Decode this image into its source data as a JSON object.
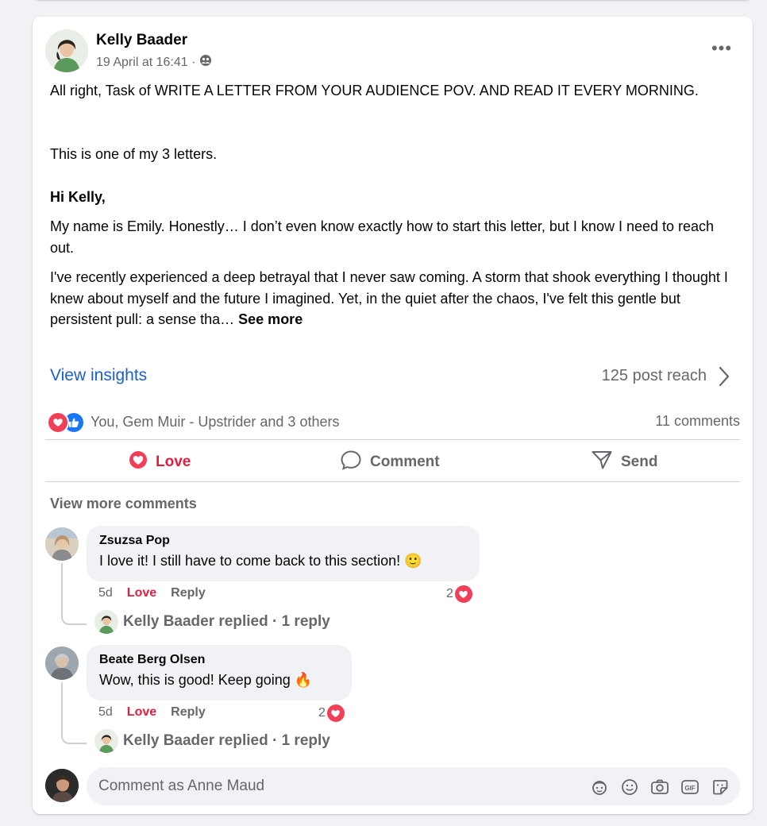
{
  "post": {
    "author": "Kelly Baader",
    "timestamp": "19 April at 16:41 ·",
    "privacy_icon": "group-icon",
    "body": {
      "p1": "All right, Task of WRITE A LETTER FROM YOUR AUDIENCE POV. AND READ IT EVERY MORNING.",
      "p2": "This is one of my 3 letters.",
      "p3": "Hi Kelly,",
      "p4": "My name is Emily. Honestly… I don’t even know exactly how to start this letter, but I know I need to reach out.",
      "p5": "I've recently experienced a deep betrayal that I never saw coming. A storm that shook everything I thought I knew about myself and the future I imagined. Yet, in the quiet after the chaos, I've felt this gentle but persistent pull: a sense tha…",
      "see_more": "See more"
    },
    "insights": {
      "label": "View insights",
      "reach": "125 post reach"
    },
    "reactions": {
      "text": "You, Gem Muir - Upstrider and 3 others",
      "comments_count": "11 comments"
    },
    "actions": {
      "love": "Love",
      "comment": "Comment",
      "send": "Send"
    }
  },
  "comments": {
    "view_more": "View more comments",
    "items": [
      {
        "name": "Zsuzsa Pop",
        "text": "I love it! I still have to come back to this section! 🙂",
        "time": "5d",
        "love": "Love",
        "reply": "Reply",
        "reaction_count": "2",
        "replied": "Kelly Baader replied · 1 reply"
      },
      {
        "name": "Beate Berg Olsen",
        "text": "Wow, this is good! Keep going 🔥",
        "time": "5d",
        "love": "Love",
        "reply": "Reply",
        "reaction_count": "2",
        "replied": "Kelly Baader replied · 1 reply"
      }
    ]
  },
  "composer": {
    "placeholder": "Comment as Anne Maud",
    "icons": [
      "avatar-sticker-icon",
      "emoji-icon",
      "camera-icon",
      "gif-icon",
      "sticker-icon"
    ]
  },
  "colors": {
    "link_blue": "#1a5fcd",
    "love_red": "#e41e3f",
    "muted_gray": "#65676b"
  }
}
